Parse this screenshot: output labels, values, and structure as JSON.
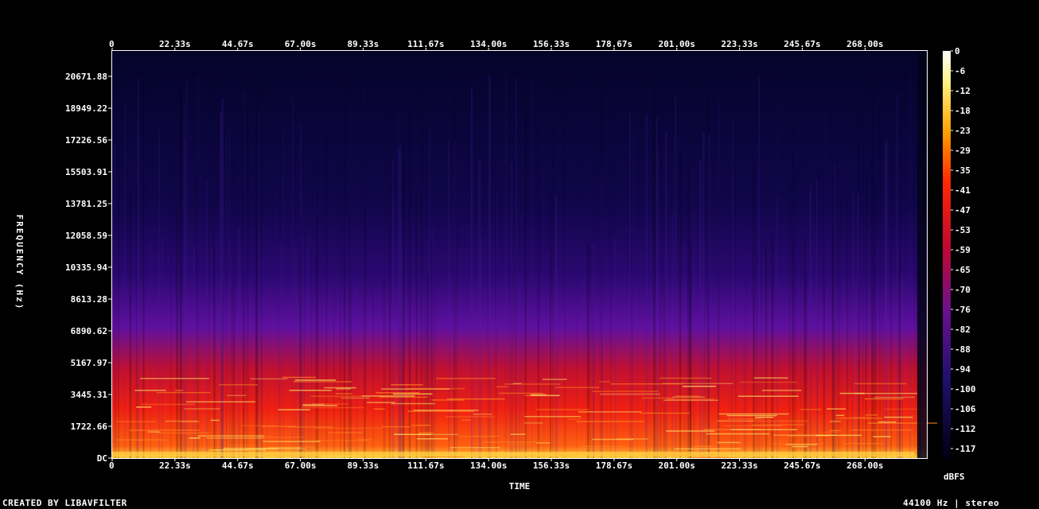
{
  "chart_data": {
    "type": "heatmap",
    "title": "",
    "xlabel": "TIME",
    "ylabel": "FREQUENCY (Hz)",
    "x_unit": "s",
    "x_range": [
      0,
      290
    ],
    "y_range": [
      0,
      22050
    ],
    "x_ticks": [
      "0",
      "22.33s",
      "44.67s",
      "67.00s",
      "89.33s",
      "111.67s",
      "134.00s",
      "156.33s",
      "178.67s",
      "201.00s",
      "223.33s",
      "245.67s",
      "268.00s"
    ],
    "x_tick_values": [
      0,
      22.33,
      44.67,
      67.0,
      89.33,
      111.67,
      134.0,
      156.33,
      178.67,
      201.0,
      223.33,
      245.67,
      268.0
    ],
    "y_ticks": [
      "DC",
      "1722.66",
      "3445.31",
      "5167.97",
      "6890.62",
      "8613.28",
      "10335.94",
      "12058.59",
      "13781.25",
      "15503.91",
      "17226.56",
      "18949.22",
      "20671.88"
    ],
    "y_tick_values": [
      0,
      1722.66,
      3445.31,
      5167.97,
      6890.62,
      8613.28,
      10335.94,
      12058.59,
      13781.25,
      15503.91,
      17226.56,
      18949.22,
      20671.88
    ],
    "colorbar": {
      "label": "dBFS",
      "ticks": [
        "0",
        "-6",
        "-12",
        "-18",
        "-23",
        "-29",
        "-35",
        "-41",
        "-47",
        "-53",
        "-59",
        "-65",
        "-70",
        "-76",
        "-82",
        "-88",
        "-94",
        "-100",
        "-106",
        "-112",
        "-117"
      ],
      "range": [
        -117,
        0
      ]
    },
    "colors": {
      "background": "#000000",
      "low": "#05052a",
      "mid": "#7a10a0",
      "high": "#ff2000",
      "peak": "#ffff80",
      "frame": "#ffffff"
    },
    "description_regions": [
      {
        "freq_from": 0,
        "freq_to": 1000,
        "level_db": -20
      },
      {
        "freq_from": 1000,
        "freq_to": 4000,
        "level_db": -35
      },
      {
        "freq_from": 4000,
        "freq_to": 7000,
        "level_db": -60
      },
      {
        "freq_from": 7000,
        "freq_to": 22050,
        "level_db": -105
      }
    ]
  },
  "footer": {
    "left": "CREATED BY LIBAVFILTER",
    "right": "44100 Hz | stereo"
  }
}
